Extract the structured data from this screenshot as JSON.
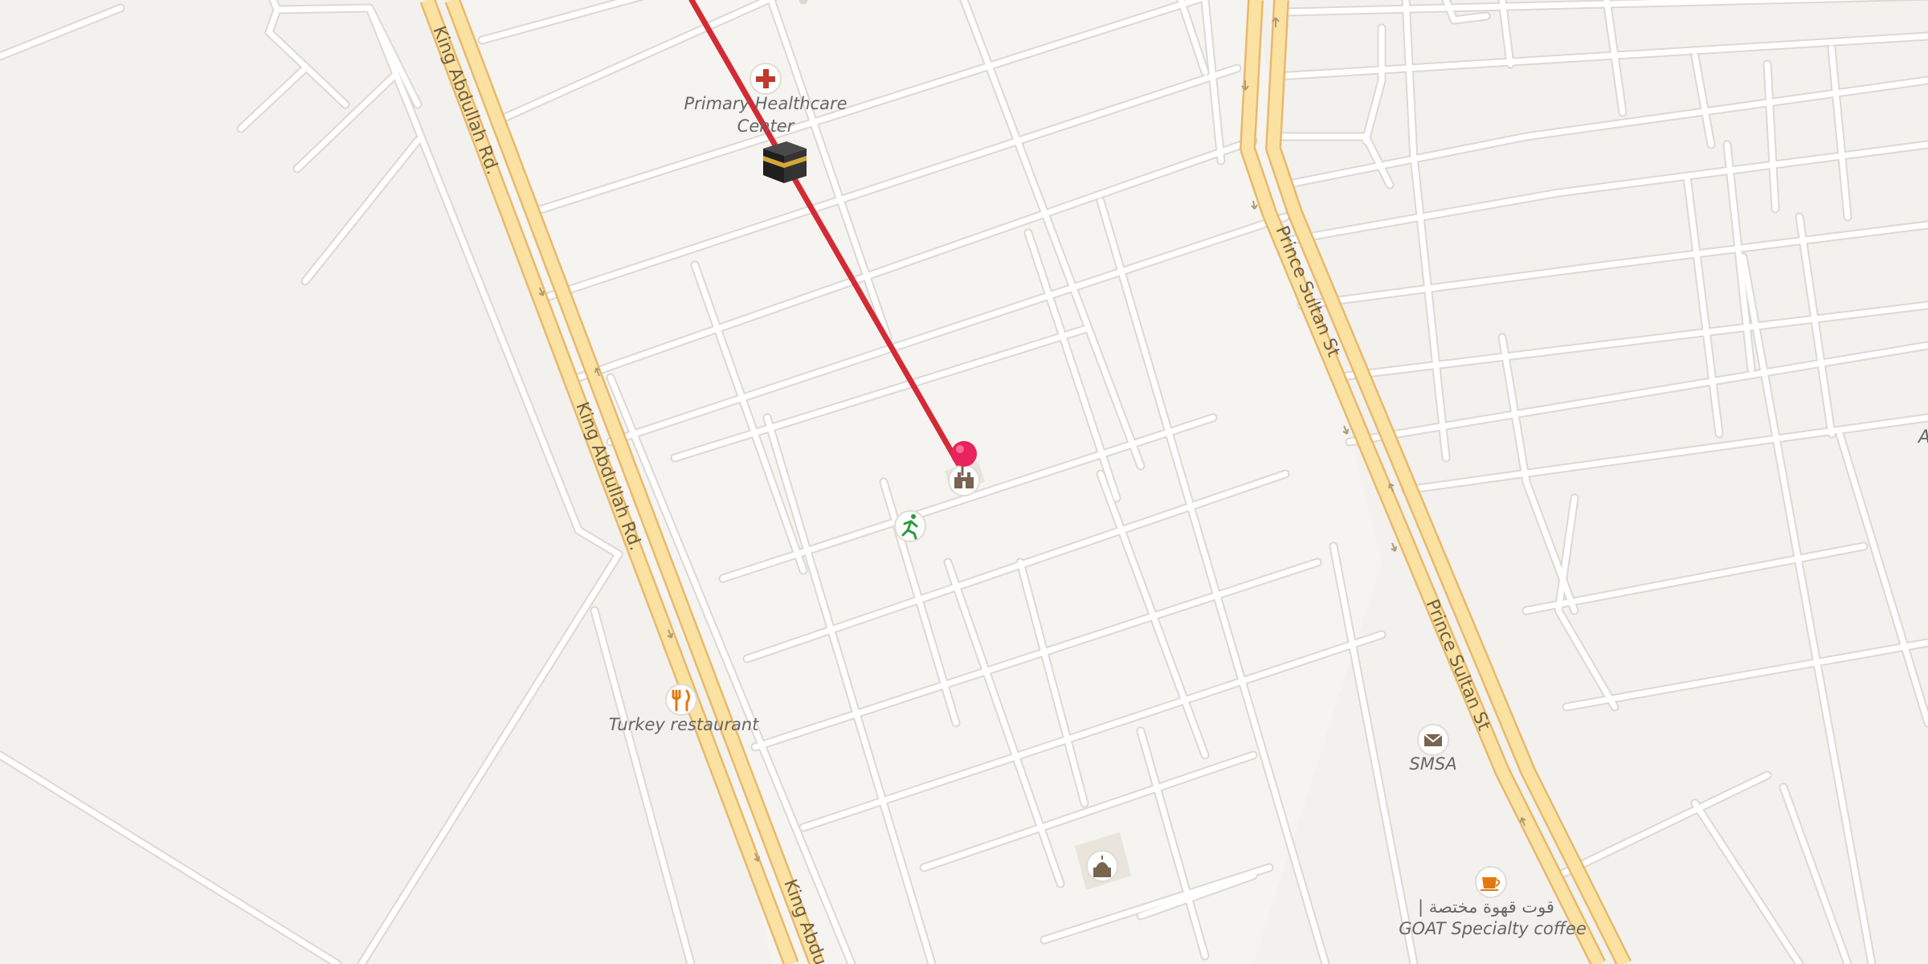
{
  "map": {
    "colors": {
      "land": "#f3f1ee",
      "block": "#f6f4f1",
      "minor_road": "#ffffff",
      "road_edge": "#dcd8d2",
      "major_road_fill": "#fbe2a2",
      "major_road_casing": "#e9b86b",
      "route_line": "#d32a35",
      "pin": "#e8245f",
      "poi_label": "#666666",
      "road_label": "#6e5f44"
    },
    "roads": [
      {
        "name": "King Abdullah Rd.",
        "labels": [
          "King Abdullah Rd.",
          "King Abdullah Rd.",
          "King Abdu"
        ]
      },
      {
        "name": "Prince Sultan St",
        "labels": [
          "Prince Sultan St",
          "Prince Sultan St"
        ]
      }
    ],
    "pois": [
      {
        "id": "hospital",
        "icon": "medical-cross-icon",
        "label_lines": [
          "Primary Healthcare",
          "Center"
        ],
        "color": "#c0392b"
      },
      {
        "id": "kaaba",
        "icon": "kaaba-icon",
        "label_lines": []
      },
      {
        "id": "pin-building",
        "icon": "building-icon",
        "label_lines": []
      },
      {
        "id": "park",
        "icon": "running-person-icon",
        "label_lines": [],
        "color": "#2e9a3e"
      },
      {
        "id": "restaurant",
        "icon": "fork-knife-icon",
        "label_lines": [
          "Turkey restaurant"
        ],
        "color": "#e07a10"
      },
      {
        "id": "smsa",
        "icon": "envelope-icon",
        "label_lines": [
          "SMSA"
        ],
        "color": "#7a6450"
      },
      {
        "id": "mosque",
        "icon": "mosque-icon",
        "label_lines": []
      },
      {
        "id": "coffee",
        "icon": "coffee-cup-icon",
        "label_lines": [
          "قوت قهوة مختصة |",
          "GOAT Specialty coffee"
        ],
        "color": "#e07a10"
      }
    ],
    "edge_label": "A",
    "marker": {
      "icon": "map-pin-icon"
    },
    "route": {
      "icon": "route-line"
    }
  }
}
